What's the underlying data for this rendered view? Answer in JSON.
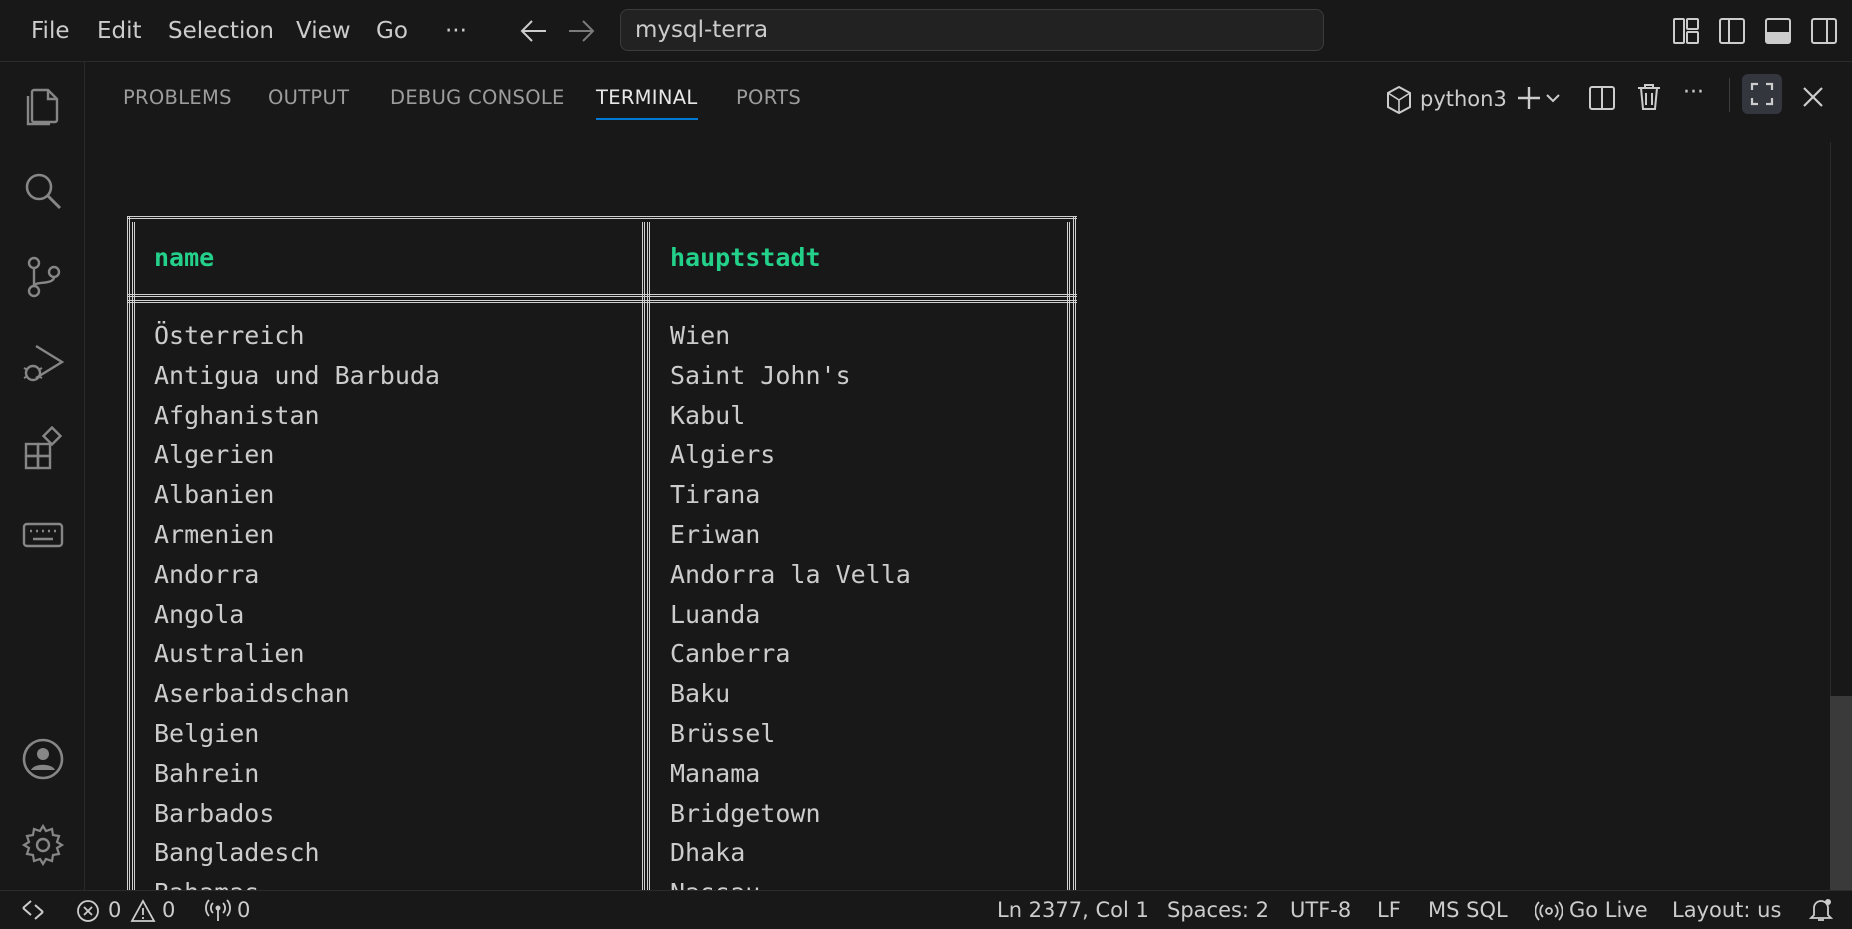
{
  "menu": {
    "items": [
      "File",
      "Edit",
      "Selection",
      "View",
      "Go"
    ],
    "more": "···"
  },
  "command_center": {
    "text": "mysql-terra"
  },
  "panel": {
    "tabs": [
      "PROBLEMS",
      "OUTPUT",
      "DEBUG CONSOLE",
      "TERMINAL",
      "PORTS"
    ],
    "active_tab": "TERMINAL",
    "terminal_profile": "python3",
    "more": "···"
  },
  "terminal": {
    "columns": [
      "name",
      "hauptstadt"
    ],
    "rows": [
      [
        "Österreich",
        "Wien"
      ],
      [
        "Antigua und Barbuda",
        "Saint John's"
      ],
      [
        "Afghanistan",
        "Kabul"
      ],
      [
        "Algerien",
        "Algiers"
      ],
      [
        "Albanien",
        "Tirana"
      ],
      [
        "Armenien",
        "Eriwan"
      ],
      [
        "Andorra",
        "Andorra la Vella"
      ],
      [
        "Angola",
        "Luanda"
      ],
      [
        "Australien",
        "Canberra"
      ],
      [
        "Aserbaidschan",
        "Baku"
      ],
      [
        "Belgien",
        "Brüssel"
      ],
      [
        "Bahrein",
        "Manama"
      ],
      [
        "Barbados",
        "Bridgetown"
      ],
      [
        "Bangladesch",
        "Dhaka"
      ],
      [
        "Bahamas",
        "Nassau"
      ]
    ],
    "prompt": ":"
  },
  "statusbar": {
    "errors": "0",
    "warnings": "0",
    "ports": "0",
    "position": "Ln 2377, Col 1",
    "spaces": "Spaces: 2",
    "encoding": "UTF-8",
    "eol": "LF",
    "language": "MS SQL",
    "go_live": "Go Live",
    "layout": "Layout: us"
  },
  "colors": {
    "background": "#181818",
    "header_text": "#23d18b",
    "accent": "#0078d4",
    "text": "#cccccc"
  }
}
